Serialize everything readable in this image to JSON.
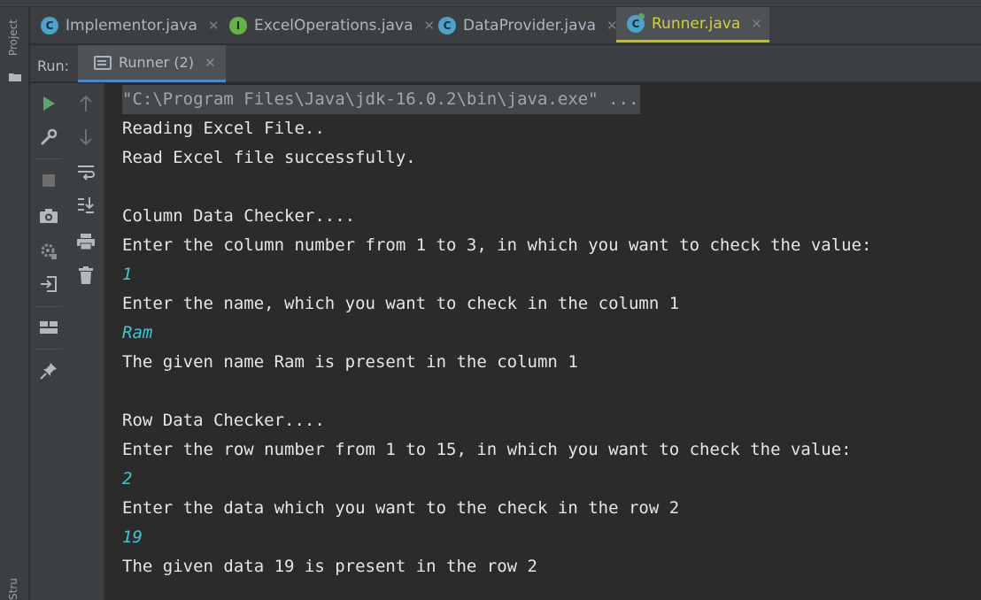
{
  "sidebar": {
    "project_label": "Project",
    "structure_label": "Structure"
  },
  "editor_tabs": [
    {
      "label": "Implementor.java",
      "icon": "c-class-icon",
      "active": false
    },
    {
      "label": "ExcelOperations.java",
      "icon": "i-interface-icon",
      "active": false
    },
    {
      "label": "DataProvider.java",
      "icon": "c-class-icon",
      "active": false
    },
    {
      "label": "Runner.java",
      "icon": "runnable-class-icon",
      "active": true
    }
  ],
  "run_window": {
    "label": "Run:",
    "tab_label": "Runner (2)"
  },
  "console": {
    "lines": [
      {
        "text": "\"C:\\Program Files\\Java\\jdk-16.0.2\\bin\\java.exe\" ...",
        "kind": "cmd"
      },
      {
        "text": "Reading Excel File..",
        "kind": "out"
      },
      {
        "text": "Read Excel file successfully.",
        "kind": "out"
      },
      {
        "text": "",
        "kind": "out"
      },
      {
        "text": "Column Data Checker....",
        "kind": "out"
      },
      {
        "text": "Enter the column number from 1 to 3, in which you want to check the value:",
        "kind": "out"
      },
      {
        "text": "1",
        "kind": "input"
      },
      {
        "text": "Enter the name, which you want to check in the column 1",
        "kind": "out"
      },
      {
        "text": "Ram",
        "kind": "input"
      },
      {
        "text": "The given name Ram is present in the column 1",
        "kind": "out"
      },
      {
        "text": "",
        "kind": "out"
      },
      {
        "text": "Row Data Checker....",
        "kind": "out"
      },
      {
        "text": "Enter the row number from 1 to 15, in which you want to check the value:",
        "kind": "out"
      },
      {
        "text": "2",
        "kind": "input"
      },
      {
        "text": "Enter the data which you want to the check in the row 2",
        "kind": "out"
      },
      {
        "text": "19",
        "kind": "input"
      },
      {
        "text": "The given data 19 is present in the row 2",
        "kind": "out"
      }
    ]
  },
  "colors": {
    "background": "#2b2b2b",
    "panel": "#3c3f41",
    "active_tab_accent": "#c7c200",
    "user_input": "#3ec7d6",
    "run_green": "#59a869"
  }
}
